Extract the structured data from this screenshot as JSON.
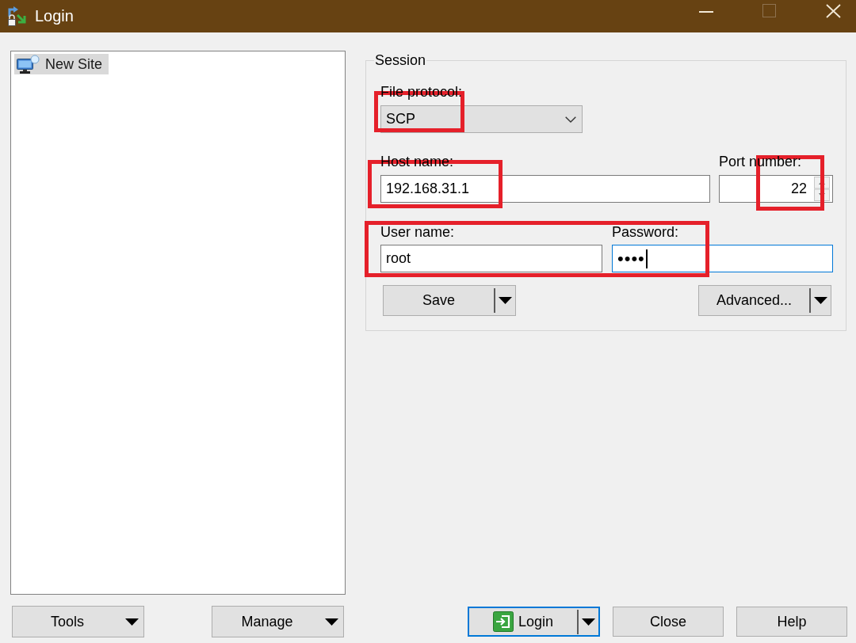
{
  "window": {
    "title": "Login",
    "maximize": {
      "disabled": true
    }
  },
  "site_tree": {
    "items": [
      {
        "label": "New Site",
        "selected": true
      }
    ]
  },
  "session": {
    "title": "Session",
    "file_protocol": {
      "label": "File protocol:",
      "value": "SCP",
      "highlighted": true
    },
    "host_name": {
      "label": "Host name:",
      "value": "192.168.31.1",
      "highlighted": true
    },
    "port_number": {
      "label": "Port number:",
      "value": "22",
      "highlighted": true
    },
    "credentials": {
      "highlighted": true,
      "user_name": {
        "label": "User name:",
        "value": "root",
        "focused": false
      },
      "password": {
        "label": "Password:",
        "value": "••••",
        "focused": true
      }
    },
    "buttons": [
      {
        "label": "Save",
        "kind": "split"
      },
      {
        "label": "Advanced...",
        "kind": "split"
      }
    ]
  },
  "footer": {
    "left_buttons": [
      {
        "label": "Tools",
        "kind": "dropdown"
      },
      {
        "label": "Manage",
        "kind": "dropdown"
      }
    ],
    "right_buttons": [
      {
        "label": "Login",
        "kind": "split",
        "default": true,
        "has_icon": true
      },
      {
        "label": "Close",
        "kind": "plain",
        "default": false,
        "has_icon": false
      },
      {
        "label": "Help",
        "kind": "plain",
        "default": false,
        "has_icon": false
      }
    ]
  }
}
